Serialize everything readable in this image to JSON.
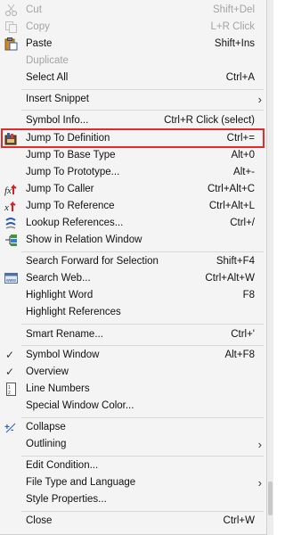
{
  "menu": {
    "items": [
      {
        "label": "Cut",
        "shortcut": "Shift+Del",
        "disabled": true
      },
      {
        "label": "Copy",
        "shortcut": "L+R Click",
        "disabled": true
      },
      {
        "label": "Paste",
        "shortcut": "Shift+Ins",
        "icon": "paste-icon"
      },
      {
        "label": "Duplicate",
        "shortcut": "",
        "disabled": true
      },
      {
        "label": "Select All",
        "shortcut": "Ctrl+A"
      },
      {
        "label": "Insert Snippet",
        "submenu": true
      },
      {
        "label": "Symbol Info...",
        "shortcut": "Ctrl+R Click (select)"
      },
      {
        "label": "Jump To Definition",
        "shortcut": "Ctrl+=",
        "icon": "jump-definition-icon"
      },
      {
        "label": "Jump To Base Type",
        "shortcut": "Alt+0"
      },
      {
        "label": "Jump To Prototype...",
        "shortcut": "Alt+-"
      },
      {
        "label": "Jump To Caller",
        "shortcut": "Ctrl+Alt+C",
        "icon": "jump-caller-icon"
      },
      {
        "label": "Jump To Reference",
        "shortcut": "Ctrl+Alt+L",
        "icon": "jump-reference-icon"
      },
      {
        "label": "Lookup References...",
        "shortcut": "Ctrl+/",
        "icon": "lookup-references-icon"
      },
      {
        "label": "Show in Relation Window",
        "shortcut": "",
        "icon": "relation-window-icon"
      },
      {
        "label": "Search Forward for Selection",
        "shortcut": "Shift+F4"
      },
      {
        "label": "Search Web...",
        "shortcut": "Ctrl+Alt+W",
        "icon": "search-web-icon"
      },
      {
        "label": "Highlight Word",
        "shortcut": "F8"
      },
      {
        "label": "Highlight References",
        "shortcut": ""
      },
      {
        "label": "Smart Rename...",
        "shortcut": "Ctrl+'"
      },
      {
        "label": "Symbol Window",
        "shortcut": "Alt+F8",
        "checked": true
      },
      {
        "label": "Overview",
        "shortcut": "",
        "checked": true
      },
      {
        "label": "Line Numbers",
        "shortcut": "",
        "icon": "line-numbers-icon"
      },
      {
        "label": "Special Window Color...",
        "shortcut": ""
      },
      {
        "label": "Collapse",
        "shortcut": "",
        "icon": "collapse-icon"
      },
      {
        "label": "Outlining",
        "submenu": true
      },
      {
        "label": "Edit Condition...",
        "shortcut": ""
      },
      {
        "label": "File Type and Language",
        "submenu": true
      },
      {
        "label": "Style Properties...",
        "shortcut": ""
      },
      {
        "label": "Close",
        "shortcut": "Ctrl+W"
      }
    ],
    "submenu_arrow": "›",
    "check_mark": "✓",
    "highlight_color": "#e52a2a"
  }
}
